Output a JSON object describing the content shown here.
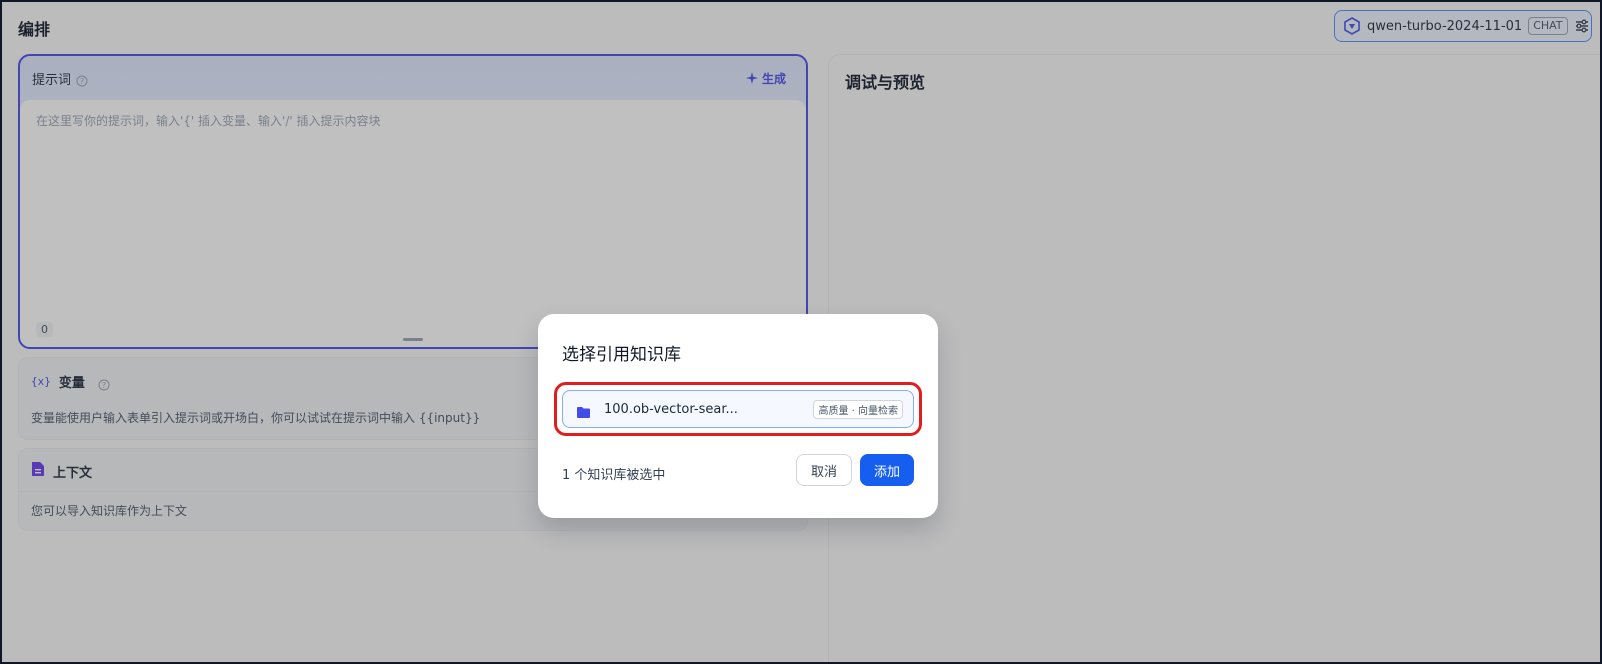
{
  "page": {
    "title": "编排"
  },
  "model": {
    "name": "qwen-turbo-2024-11-01",
    "mode_tag": "CHAT",
    "logo_icon": "qwen-logo-icon",
    "settings_icon": "sliders-icon"
  },
  "prompt": {
    "label": "提示词",
    "generate_label": "生成",
    "placeholder": "在这里写你的提示词，输入'{' 插入变量、输入'/' 插入提示内容块",
    "char_count": "0"
  },
  "variables": {
    "icon_text": "{x}",
    "title": "变量",
    "description": "变量能使用户输入表单引入提示词或开场白，你可以试试在提示词中输入 {{input}}"
  },
  "context": {
    "title": "上下文",
    "description": "您可以导入知识库作为上下文"
  },
  "preview": {
    "title": "调试与预览"
  },
  "modal": {
    "title": "选择引用知识库",
    "knowledge_base": {
      "name": "100.ob-vector-sear...",
      "tag": "高质量 · 向量检索"
    },
    "selected_count": "1 个知识库被选中",
    "cancel_label": "取消",
    "add_label": "添加"
  },
  "colors": {
    "accent": "#444ce7",
    "primary_button": "#155eef",
    "highlight": "#e01e1e"
  }
}
